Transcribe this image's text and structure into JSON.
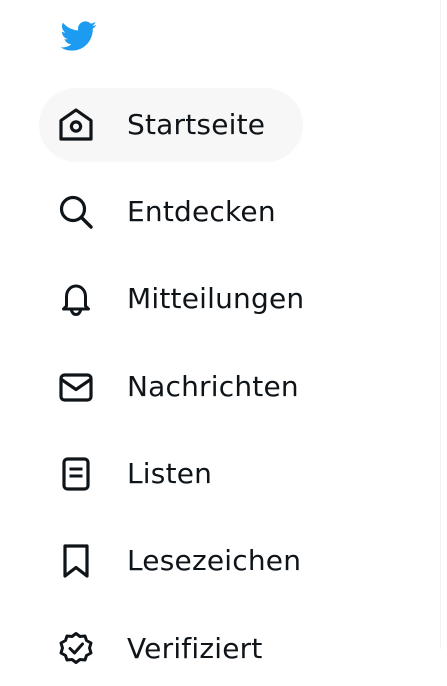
{
  "brand": {
    "logo_icon": "twitter-bird-icon",
    "color": "#1d9bf0"
  },
  "colors": {
    "text": "#0f1419",
    "active_bg": "#f7f7f7",
    "divider": "#eff3f4"
  },
  "nav": {
    "items": [
      {
        "label": "Startseite",
        "icon": "home-icon",
        "active": true
      },
      {
        "label": "Entdecken",
        "icon": "search-icon",
        "active": false
      },
      {
        "label": "Mitteilungen",
        "icon": "bell-icon",
        "active": false
      },
      {
        "label": "Nachrichten",
        "icon": "envelope-icon",
        "active": false
      },
      {
        "label": "Listen",
        "icon": "list-icon",
        "active": false
      },
      {
        "label": "Lesezeichen",
        "icon": "bookmark-icon",
        "active": false
      },
      {
        "label": "Verifiziert",
        "icon": "verified-icon",
        "active": false
      }
    ]
  }
}
